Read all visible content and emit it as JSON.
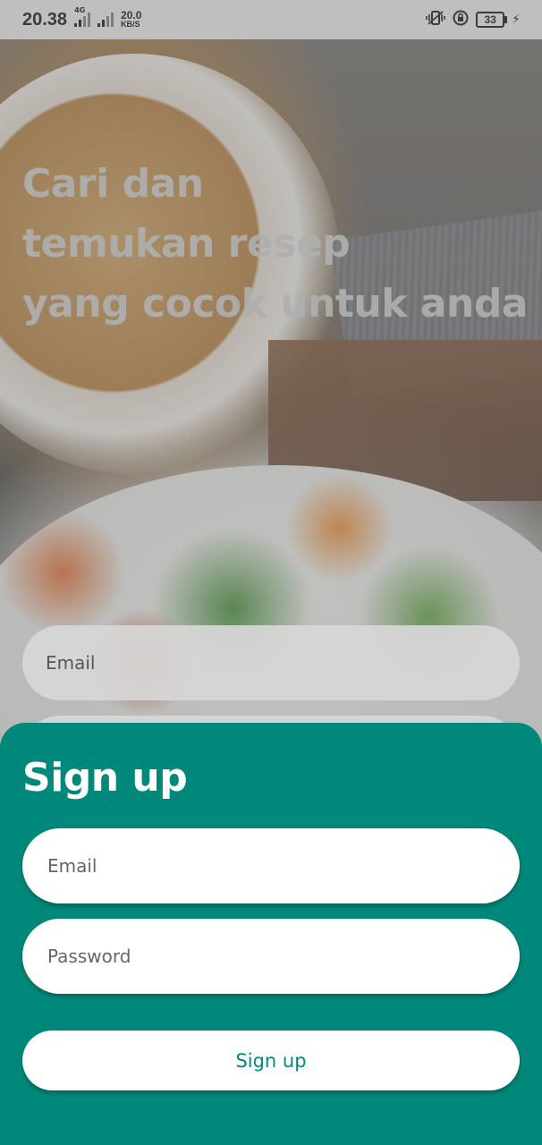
{
  "status_bar": {
    "time": "20.38",
    "network_type": "4G",
    "speed_value": "20.0",
    "speed_unit": "KB/S",
    "battery_level": "33"
  },
  "hero": {
    "line1": "Cari dan",
    "line2": "temukan resep",
    "line3": "yang cocok untuk anda"
  },
  "background_form": {
    "email_placeholder": "Email"
  },
  "signup_sheet": {
    "title": "Sign up",
    "email_placeholder": "Email",
    "password_placeholder": "Password",
    "submit_label": "Sign up"
  },
  "colors": {
    "accent": "#00897b",
    "field_bg": "#ffffff",
    "status_bar_bg": "#bfbfbf"
  },
  "icons": [
    "vibrate-icon",
    "rotation-lock-icon",
    "battery-icon",
    "charging-icon",
    "signal-icon"
  ]
}
